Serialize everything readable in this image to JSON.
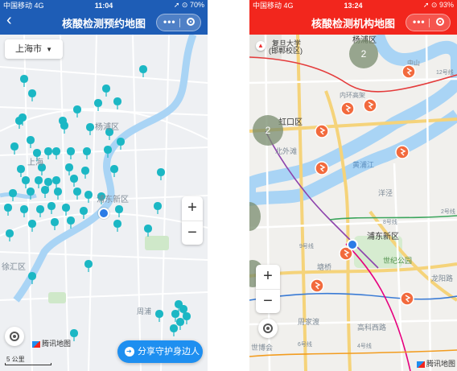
{
  "left": {
    "status": {
      "carrier": "中国移动 4G",
      "time": "11:04",
      "indicators": "➚ ⊙ 70%"
    },
    "title": "核酸检测预约地图",
    "city": "上海市",
    "zoom_in": "+",
    "zoom_out": "−",
    "map_labels": {
      "yangpu": "杨浦区",
      "pudong": "浦东新区",
      "xuhui": "徐汇区",
      "shang": "上海",
      "zhou": "周浦"
    },
    "logo": "腾讯地图",
    "scale": "5 公里",
    "share_label": "分享守护身边人",
    "pin_color": "#1bb7c4",
    "accent": "#1e8ff0"
  },
  "right": {
    "status": {
      "carrier": "中国移动 4G",
      "time": "13:24",
      "indicators": "➚ ⊙ 93%"
    },
    "title": "核酸检测机构地图",
    "map_labels": {
      "fudan": "复旦大学",
      "fudan_sub": "(邯郸校区)",
      "yangpu": "杨浦区",
      "hongkou": "虹口区",
      "beiwaitan": "北外滩",
      "huangpujiang": "黄浦江",
      "pudong": "浦东新区",
      "century": "世纪公园",
      "tangqiao": "塘桥",
      "yangjing": "洋泾",
      "zhoujiadu": "周家渡",
      "gaoke": "高科西路",
      "shibo": "世博会",
      "longyang": "龙阳路",
      "l8": "8号线",
      "l9": "9号线",
      "l12": "12号线",
      "l2": "2号线",
      "l6": "6号线",
      "l4": "4号线",
      "neihuan": "内环高架",
      "zhongshan": "中山"
    },
    "clusters": [
      "2",
      "2"
    ],
    "zoom_in": "+",
    "zoom_out": "−",
    "logo": "腾讯地图",
    "accent": "#f2261d",
    "marker_color": "#f26a3d"
  }
}
